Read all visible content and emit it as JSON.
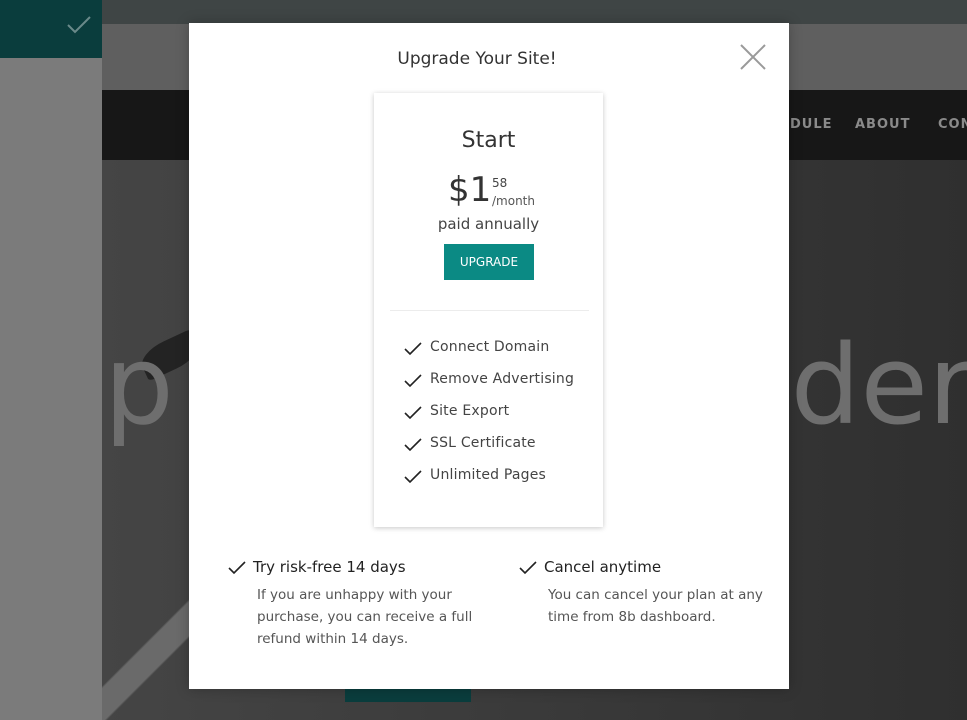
{
  "background": {
    "nav_items": [
      "DULE",
      "ABOUT",
      "CON"
    ],
    "hero_text_left": "p",
    "hero_text_right": "lder"
  },
  "modal": {
    "title": "Upgrade Your Site!",
    "plan": {
      "name": "Start",
      "price_whole": "$1",
      "price_cents": "58",
      "price_period": "/month",
      "billing": "paid annually",
      "button_label": "UPGRADE",
      "features": [
        "Connect Domain",
        "Remove Advertising",
        "Site Export",
        "SSL Certificate",
        "Unlimited Pages"
      ]
    },
    "info": [
      {
        "title": "Try risk-free 14 days",
        "text": "If you are unhappy with your purchase, you can receive a full refund within 14 days."
      },
      {
        "title": "Cancel anytime",
        "text": "You can cancel your plan at any time from 8b dashboard."
      }
    ]
  },
  "colors": {
    "accent": "#0b8a84",
    "overlay_dark": "#0a3d3d"
  },
  "icons": [
    "check-icon",
    "close-icon"
  ]
}
